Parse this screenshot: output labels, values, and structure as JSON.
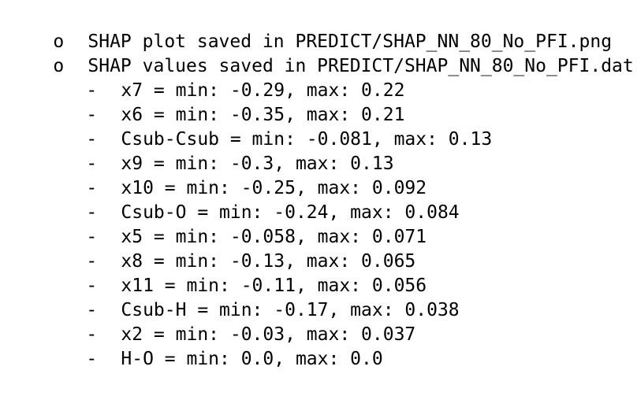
{
  "output": {
    "bullets": [
      {
        "marker": "o",
        "text": "SHAP plot saved in PREDICT/SHAP_NN_80_No_PFI.png"
      },
      {
        "marker": "o",
        "text": "SHAP values saved in PREDICT/SHAP_NN_80_No_PFI.dat:"
      }
    ],
    "items": [
      {
        "marker": "-",
        "text": "x7 = min: -0.29, max: 0.22"
      },
      {
        "marker": "-",
        "text": "x6 = min: -0.35, max: 0.21"
      },
      {
        "marker": "-",
        "text": "Csub-Csub = min: -0.081, max: 0.13"
      },
      {
        "marker": "-",
        "text": "x9 = min: -0.3, max: 0.13"
      },
      {
        "marker": "-",
        "text": "x10 = min: -0.25, max: 0.092"
      },
      {
        "marker": "-",
        "text": "Csub-O = min: -0.24, max: 0.084"
      },
      {
        "marker": "-",
        "text": "x5 = min: -0.058, max: 0.071"
      },
      {
        "marker": "-",
        "text": "x8 = min: -0.13, max: 0.065"
      },
      {
        "marker": "-",
        "text": "x11 = min: -0.11, max: 0.056"
      },
      {
        "marker": "-",
        "text": "Csub-H = min: -0.17, max: 0.038"
      },
      {
        "marker": "-",
        "text": "x2 = min: -0.03, max: 0.037"
      },
      {
        "marker": "-",
        "text": "H-O = min: 0.0, max: 0.0"
      }
    ]
  }
}
